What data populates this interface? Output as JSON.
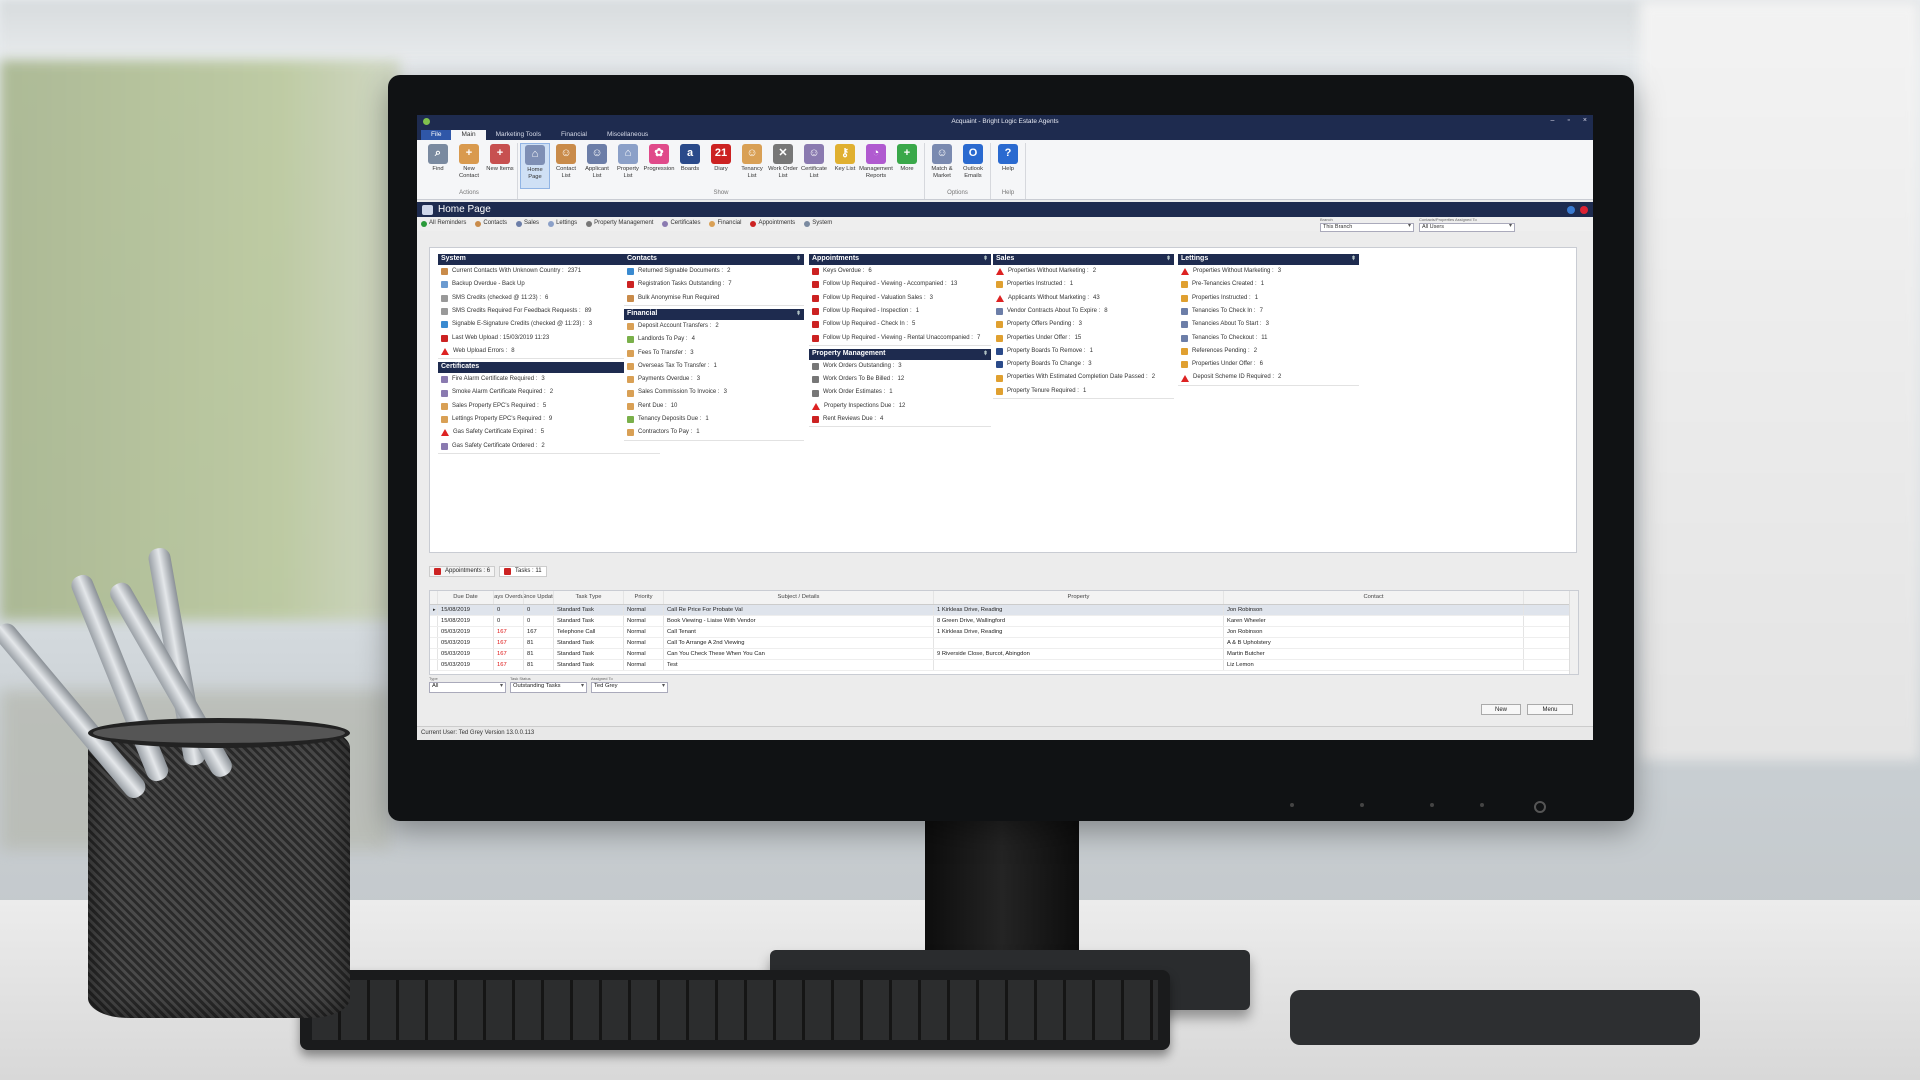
{
  "window": {
    "title": "Acquaint - Bright Logic Estate Agents",
    "minimize": "–",
    "restore": "▫",
    "close": "×"
  },
  "ribbon_tabs": [
    "File",
    "Main",
    "Marketing Tools",
    "Financial",
    "Miscellaneous"
  ],
  "ribbon": {
    "actions": {
      "label": "Actions",
      "buttons": [
        {
          "label": "Find",
          "icon": "magnifier-icon",
          "color": "#7a8aa0",
          "glyph": "⌕"
        },
        {
          "label": "New Contact",
          "icon": "new-contact-icon",
          "color": "#d99a4e",
          "glyph": "+"
        },
        {
          "label": "New Items",
          "icon": "new-items-icon",
          "color": "#c75050",
          "glyph": "+"
        }
      ]
    },
    "show": {
      "label": "Show",
      "buttons": [
        {
          "label": "Home Page",
          "icon": "home-page-icon",
          "color": "#7e8fb5",
          "glyph": "⌂"
        },
        {
          "label": "Contact List",
          "icon": "contact-list-icon",
          "color": "#c98b4a",
          "glyph": "☺"
        },
        {
          "label": "Applicant List",
          "icon": "applicant-list-icon",
          "color": "#6c7ea8",
          "glyph": "☺"
        },
        {
          "label": "Property List",
          "icon": "property-list-icon",
          "color": "#8ba0c8",
          "glyph": "⌂"
        },
        {
          "label": "Progression",
          "icon": "progression-icon",
          "color": "#e04a8a",
          "glyph": "✿"
        },
        {
          "label": "Boards",
          "icon": "boards-icon",
          "color": "#2a4a8a",
          "glyph": "a"
        },
        {
          "label": "Diary",
          "icon": "diary-icon",
          "color": "#c22",
          "glyph": "21"
        },
        {
          "label": "Tenancy List",
          "icon": "tenancy-list-icon",
          "color": "#d9a055",
          "glyph": "☺"
        },
        {
          "label": "Work Order List",
          "icon": "work-order-icon",
          "color": "#777",
          "glyph": "✕"
        },
        {
          "label": "Certificate List",
          "icon": "certificate-list-icon",
          "color": "#8a7ab0",
          "glyph": "☺"
        },
        {
          "label": "Key List",
          "icon": "key-list-icon",
          "color": "#e0b030",
          "glyph": "⚷"
        },
        {
          "label": "Management Reports",
          "icon": "management-reports-icon",
          "color": "#b05ad0",
          "glyph": "◔"
        },
        {
          "label": "More",
          "icon": "more-icon",
          "color": "#3aa84a",
          "glyph": "+"
        }
      ]
    },
    "options": {
      "label": "Options",
      "buttons": [
        {
          "label": "Match & Market",
          "icon": "match-market-icon",
          "color": "#7a8ab0",
          "glyph": "☺"
        },
        {
          "label": "Outlook Emails",
          "icon": "outlook-icon",
          "color": "#2a6ad0",
          "glyph": "O"
        }
      ]
    },
    "help": {
      "label": "Help",
      "buttons": [
        {
          "label": "Help",
          "icon": "help-icon",
          "color": "#2a6ad0",
          "glyph": "?"
        }
      ]
    }
  },
  "page_title": "Home Page",
  "filter_tabs": [
    {
      "label": "All Reminders",
      "color": "#2a9a3a"
    },
    {
      "label": "Contacts",
      "color": "#c98b4a"
    },
    {
      "label": "Sales",
      "color": "#6c7ea8"
    },
    {
      "label": "Lettings",
      "color": "#8ba0c8"
    },
    {
      "label": "Property Management",
      "color": "#777"
    },
    {
      "label": "Certificates",
      "color": "#8a7ab0"
    },
    {
      "label": "Financial",
      "color": "#d9a055"
    },
    {
      "label": "Appointments",
      "color": "#c22"
    },
    {
      "label": "System",
      "color": "#7a8aa0"
    }
  ],
  "branch": {
    "label": "Branch",
    "value": "This Branch"
  },
  "assigned": {
    "label": "Contacts/Properties Assigned To",
    "value": "All Users"
  },
  "panels": {
    "system": {
      "title": "System",
      "items": [
        {
          "text": "Current Contacts With Unknown Country :",
          "count": "2371",
          "icon": "contacts-icon",
          "color": "#c98b4a"
        },
        {
          "text": "Backup Overdue - Back Up",
          "count": "",
          "icon": "backup-icon",
          "color": "#6a9ad0"
        },
        {
          "text": "SMS Credits (checked @ 11:23) :",
          "count": "6",
          "icon": "sms-icon",
          "color": "#999"
        },
        {
          "text": "SMS Credits Required For Feedback Requests :",
          "count": "89",
          "icon": "sms-icon",
          "color": "#999"
        },
        {
          "text": "Signable E-Signature Credits (checked @ 11:23) :",
          "count": "3",
          "icon": "signable-icon",
          "color": "#3a8ad0"
        },
        {
          "text": "Last Web Upload : 15/03/2019 11:23",
          "count": "",
          "icon": "web-upload-icon",
          "color": "#c22"
        },
        {
          "text": "Web Upload Errors :",
          "count": "8",
          "icon": "warning-icon",
          "color": "#d22"
        }
      ]
    },
    "certificates": {
      "title": "Certificates",
      "items": [
        {
          "text": "Fire Alarm Certificate Required :",
          "count": "3",
          "icon": "certificate-icon",
          "color": "#8a7ab0"
        },
        {
          "text": "Smoke Alarm Certificate Required :",
          "count": "2",
          "icon": "certificate-icon",
          "color": "#8a7ab0"
        },
        {
          "text": "Sales Property EPC's Required :",
          "count": "5",
          "icon": "epc-icon",
          "color": "#d9a055"
        },
        {
          "text": "Lettings Property EPC's Required :",
          "count": "9",
          "icon": "epc-icon",
          "color": "#d9a055"
        },
        {
          "text": "Gas Safety Certificate Expired :",
          "count": "5",
          "icon": "warning-icon",
          "color": "#d22"
        },
        {
          "text": "Gas Safety Certificate Ordered :",
          "count": "2",
          "icon": "certificate-icon",
          "color": "#8a7ab0"
        }
      ]
    },
    "contacts": {
      "title": "Contacts",
      "items": [
        {
          "text": "Returned Signable Documents :",
          "count": "2",
          "icon": "signable-icon",
          "color": "#3a8ad0"
        },
        {
          "text": "Registration Tasks Outstanding :",
          "count": "7",
          "icon": "task-icon",
          "color": "#c22"
        },
        {
          "text": "Bulk Anonymise Run Required",
          "count": "",
          "icon": "anonymise-icon",
          "color": "#c98b4a"
        }
      ]
    },
    "financial": {
      "title": "Financial",
      "items": [
        {
          "text": "Deposit Account Transfers :",
          "count": "2",
          "icon": "deposit-icon",
          "color": "#d9a055"
        },
        {
          "text": "Landlords To Pay :",
          "count": "4",
          "icon": "landlord-icon",
          "color": "#7ab04a"
        },
        {
          "text": "Fees To Transfer :",
          "count": "3",
          "icon": "fees-icon",
          "color": "#d9a055"
        },
        {
          "text": "Overseas Tax To Transfer :",
          "count": "1",
          "icon": "tax-icon",
          "color": "#d9a055"
        },
        {
          "text": "Payments Overdue :",
          "count": "3",
          "icon": "payments-icon",
          "color": "#d9a055"
        },
        {
          "text": "Sales Commission To Invoice :",
          "count": "3",
          "icon": "commission-icon",
          "color": "#d9a055"
        },
        {
          "text": "Rent Due :",
          "count": "10",
          "icon": "rent-icon",
          "color": "#d9a055"
        },
        {
          "text": "Tenancy Deposits Due :",
          "count": "1",
          "icon": "tenancy-deposit-icon",
          "color": "#7ab04a"
        },
        {
          "text": "Contractors To Pay :",
          "count": "1",
          "icon": "contractors-icon",
          "color": "#d9a055"
        }
      ]
    },
    "appointments": {
      "title": "Appointments",
      "items": [
        {
          "text": "Keys Overdue :",
          "count": "6",
          "icon": "key-icon",
          "color": "#c22"
        },
        {
          "text": "Follow Up Required - Viewing - Accompanied :",
          "count": "13",
          "icon": "diary-icon",
          "color": "#c22"
        },
        {
          "text": "Follow Up Required - Valuation Sales :",
          "count": "3",
          "icon": "diary-icon",
          "color": "#c22"
        },
        {
          "text": "Follow Up Required - Inspection :",
          "count": "1",
          "icon": "diary-icon",
          "color": "#c22"
        },
        {
          "text": "Follow Up Required - Check In :",
          "count": "5",
          "icon": "diary-icon",
          "color": "#c22"
        },
        {
          "text": "Follow Up Required - Viewing - Rental Unaccompanied :",
          "count": "7",
          "icon": "diary-icon",
          "color": "#c22"
        }
      ]
    },
    "property_management": {
      "title": "Property Management",
      "items": [
        {
          "text": "Work Orders Outstanding :",
          "count": "3",
          "icon": "work-order-icon",
          "color": "#777"
        },
        {
          "text": "Work Orders To Be Billed :",
          "count": "12",
          "icon": "work-order-icon",
          "color": "#777"
        },
        {
          "text": "Work Order Estimates :",
          "count": "1",
          "icon": "work-order-icon",
          "color": "#777"
        },
        {
          "text": "Property Inspections Due :",
          "count": "12",
          "icon": "warning-icon",
          "color": "#d22"
        },
        {
          "text": "Rent Reviews Due :",
          "count": "4",
          "icon": "rent-review-icon",
          "color": "#c22"
        }
      ]
    },
    "sales": {
      "title": "Sales",
      "items": [
        {
          "text": "Properties Without Marketing :",
          "count": "2",
          "icon": "warning-icon",
          "color": "#d22"
        },
        {
          "text": "Properties Instructed :",
          "count": "1",
          "icon": "instructed-icon",
          "color": "#e0a030"
        },
        {
          "text": "Applicants Without Marketing :",
          "count": "43",
          "icon": "warning-icon",
          "color": "#d22"
        },
        {
          "text": "Vendor Contracts About To Expire :",
          "count": "8",
          "icon": "contract-icon",
          "color": "#6c7ea8"
        },
        {
          "text": "Property Offers Pending :",
          "count": "3",
          "icon": "offers-icon",
          "color": "#e0a030"
        },
        {
          "text": "Properties Under Offer :",
          "count": "15",
          "icon": "offers-icon",
          "color": "#e0a030"
        },
        {
          "text": "Property Boards To Remove :",
          "count": "1",
          "icon": "boards-icon",
          "color": "#2a4a8a"
        },
        {
          "text": "Property Boards To Change :",
          "count": "3",
          "icon": "boards-icon",
          "color": "#2a4a8a"
        },
        {
          "text": "Properties With Estimated Completion Date Passed :",
          "count": "2",
          "icon": "completion-icon",
          "color": "#e0a030"
        },
        {
          "text": "Property Tenure Required :",
          "count": "1",
          "icon": "tenure-icon",
          "color": "#e0a030"
        }
      ]
    },
    "lettings": {
      "title": "Lettings",
      "items": [
        {
          "text": "Properties Without Marketing :",
          "count": "3",
          "icon": "warning-icon",
          "color": "#d22"
        },
        {
          "text": "Pre-Tenancies Created :",
          "count": "1",
          "icon": "pre-tenancy-icon",
          "color": "#e0a030"
        },
        {
          "text": "Properties Instructed :",
          "count": "1",
          "icon": "instructed-icon",
          "color": "#e0a030"
        },
        {
          "text": "Tenancies To Check In :",
          "count": "7",
          "icon": "tenancy-icon",
          "color": "#6c7ea8"
        },
        {
          "text": "Tenancies About To Start :",
          "count": "3",
          "icon": "tenancy-icon",
          "color": "#6c7ea8"
        },
        {
          "text": "Tenancies To Checkout :",
          "count": "11",
          "icon": "tenancy-icon",
          "color": "#6c7ea8"
        },
        {
          "text": "References Pending :",
          "count": "2",
          "icon": "references-icon",
          "color": "#e0a030"
        },
        {
          "text": "Properties Under Offer :",
          "count": "6",
          "icon": "offers-icon",
          "color": "#e0a030"
        },
        {
          "text": "Deposit Scheme ID Required :",
          "count": "2",
          "icon": "warning-icon",
          "color": "#d22"
        }
      ]
    }
  },
  "bottom_tabs": [
    {
      "label": "Appointments : 6",
      "icon": "diary-icon"
    },
    {
      "label": "Tasks : 11",
      "icon": "task-icon"
    }
  ],
  "task_table": {
    "headers": [
      "Due Date",
      "Days Overdue",
      "Since Update",
      "Task Type",
      "Priority",
      "Subject / Details",
      "Property",
      "Contact"
    ],
    "rows": [
      [
        "15/08/2019",
        "0",
        "0",
        "Standard Task",
        "Normal",
        "Call Re Price For Probate Val",
        "1 Kirkleas Drive, Reading",
        "Jon Robinson"
      ],
      [
        "15/08/2019",
        "0",
        "0",
        "Standard Task",
        "Normal",
        "Book Viewing - Liaise With Vendor",
        "8 Green Drive, Wallingford",
        "Karen Wheeler"
      ],
      [
        "05/03/2019",
        "167",
        "167",
        "Telephone Call",
        "Normal",
        "Call Tenant",
        "1 Kirkleas Drive, Reading",
        "Jon Robinson"
      ],
      [
        "05/03/2019",
        "167",
        "81",
        "Standard Task",
        "Normal",
        "Call To Arrange A 2nd Viewing",
        "",
        "A & B Upholstery"
      ],
      [
        "05/03/2019",
        "167",
        "81",
        "Standard Task",
        "Normal",
        "Can You Check These When You Can",
        "9 Riverside Close, Burcot, Abingdon",
        "Martin Butcher"
      ],
      [
        "05/03/2019",
        "167",
        "81",
        "Standard Task",
        "Normal",
        "Test",
        "",
        "Liz Lemon"
      ]
    ]
  },
  "bottom_filters": [
    {
      "label": "Type",
      "value": "All"
    },
    {
      "label": "Task Status",
      "value": "Outstanding Tasks"
    },
    {
      "label": "Assigned To",
      "value": "Ted Grey"
    }
  ],
  "buttons": {
    "new": "New",
    "menu": "Menu"
  },
  "status": "Current User: Ted Grey   Version 13.0.0.113"
}
